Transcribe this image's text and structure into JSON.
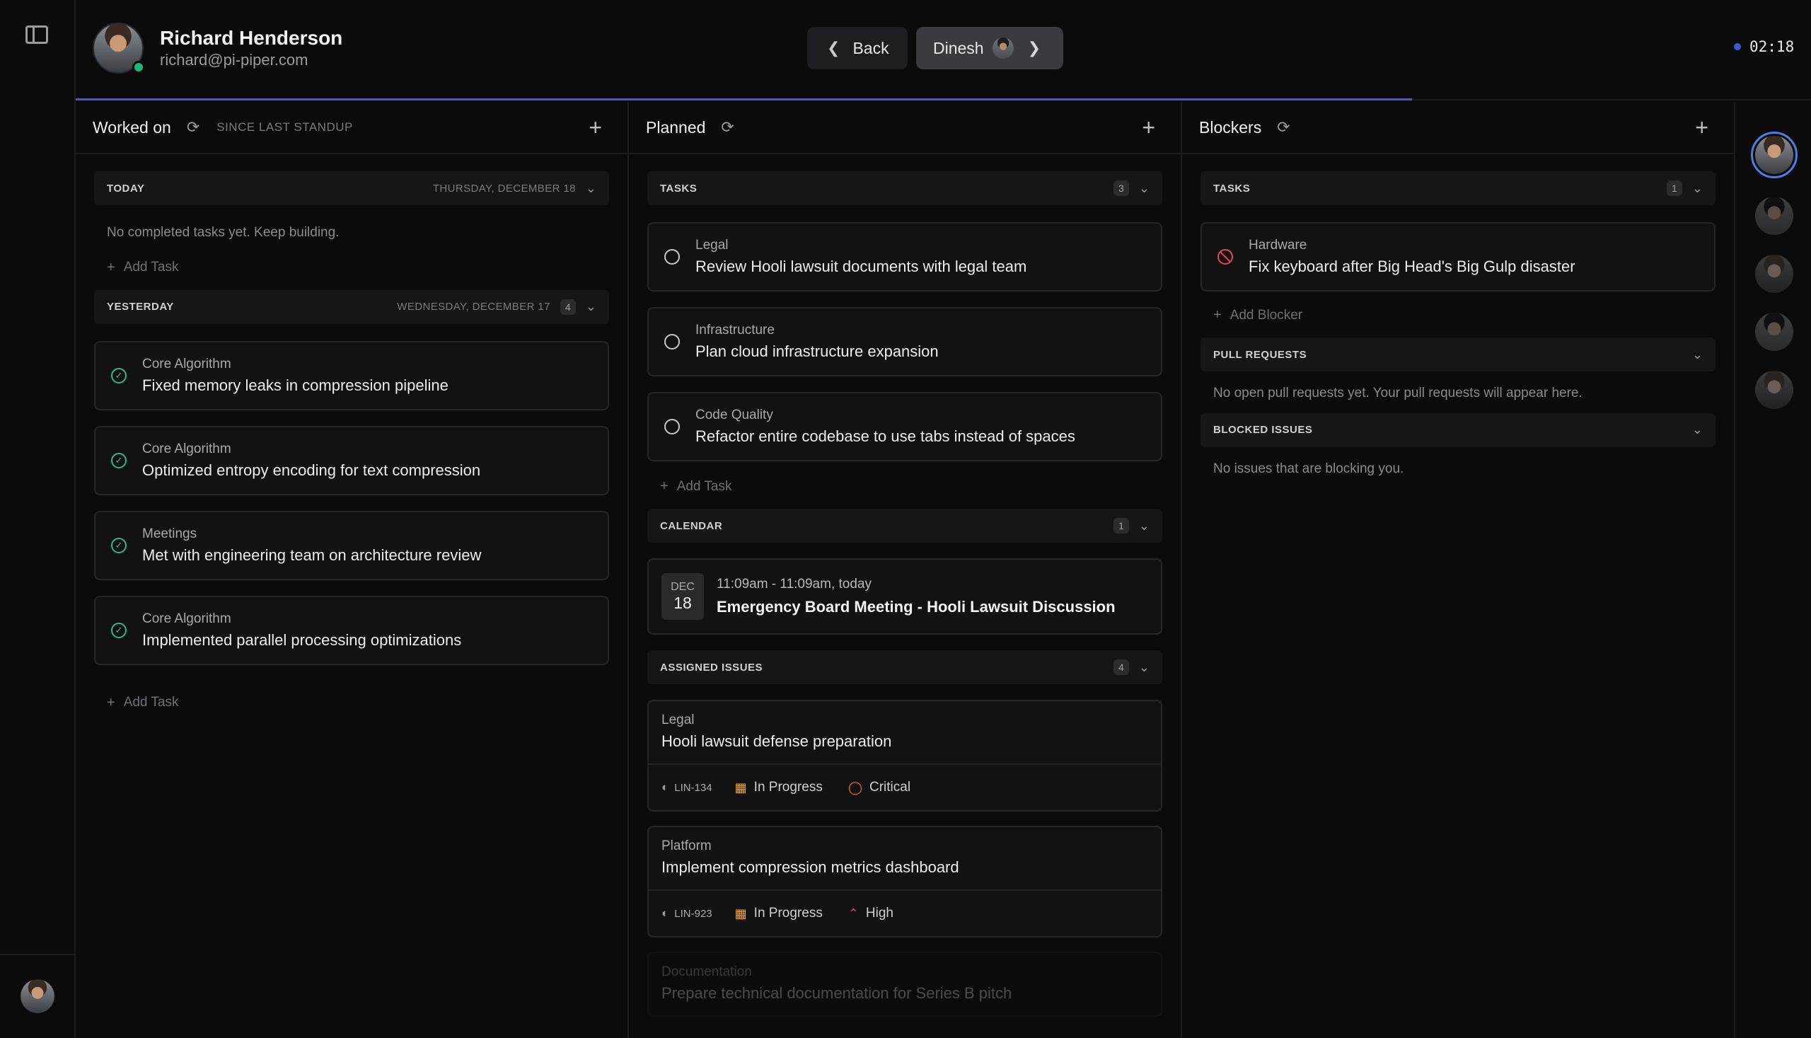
{
  "user": {
    "name": "Richard Henderson",
    "email": "richard@pi-piper.com"
  },
  "nav": {
    "back_label": "Back",
    "next_label": "Dinesh"
  },
  "timer": "02:18",
  "columns": {
    "worked_on": {
      "title": "Worked on",
      "subtitle": "SINCE LAST STANDUP",
      "today": {
        "label": "TODAY",
        "date": "THURSDAY, DECEMBER 18",
        "empty": "No completed tasks yet. Keep building.",
        "add": "Add Task"
      },
      "yesterday": {
        "label": "YESTERDAY",
        "date": "WEDNESDAY, DECEMBER 17",
        "count": "4",
        "items": [
          {
            "category": "Core Algorithm",
            "title": "Fixed memory leaks in compression pipeline"
          },
          {
            "category": "Core Algorithm",
            "title": "Optimized entropy encoding for text compression"
          },
          {
            "category": "Meetings",
            "title": "Met with engineering team on architecture review"
          },
          {
            "category": "Core Algorithm",
            "title": "Implemented parallel processing optimizations"
          }
        ],
        "add": "Add Task"
      }
    },
    "planned": {
      "title": "Planned",
      "tasks": {
        "label": "TASKS",
        "count": "3",
        "items": [
          {
            "category": "Legal",
            "title": "Review Hooli lawsuit documents with legal team"
          },
          {
            "category": "Infrastructure",
            "title": "Plan cloud infrastructure expansion"
          },
          {
            "category": "Code Quality",
            "title": "Refactor entire codebase to use tabs instead of spaces"
          }
        ],
        "add": "Add Task"
      },
      "calendar": {
        "label": "CALENDAR",
        "count": "1",
        "event": {
          "month": "DEC",
          "day": "18",
          "time": "11:09am - 11:09am, today",
          "title": "Emergency Board Meeting - Hooli Lawsuit Discussion"
        }
      },
      "assigned": {
        "label": "ASSIGNED ISSUES",
        "count": "4",
        "items": [
          {
            "category": "Legal",
            "title": "Hooli lawsuit defense preparation",
            "id": "LIN-134",
            "status": "In Progress",
            "priority": "Critical"
          },
          {
            "category": "Platform",
            "title": "Implement compression metrics dashboard",
            "id": "LIN-923",
            "status": "In Progress",
            "priority": "High"
          },
          {
            "category": "Documentation",
            "title": "Prepare technical documentation for Series B pitch"
          }
        ]
      }
    },
    "blockers": {
      "title": "Blockers",
      "tasks": {
        "label": "TASKS",
        "count": "1",
        "items": [
          {
            "category": "Hardware",
            "title": "Fix keyboard after Big Head's Big Gulp disaster"
          }
        ],
        "add": "Add Blocker"
      },
      "pull_requests": {
        "label": "PULL REQUESTS",
        "empty": "No open pull requests yet. Your pull requests will appear here."
      },
      "blocked_issues": {
        "label": "BLOCKED ISSUES",
        "empty": "No issues that are blocking you."
      }
    }
  },
  "colors": {
    "accent": "#3b5bdb",
    "done": "#2fb98a",
    "blocker": "#e5484d",
    "online": "#1fb57a"
  }
}
